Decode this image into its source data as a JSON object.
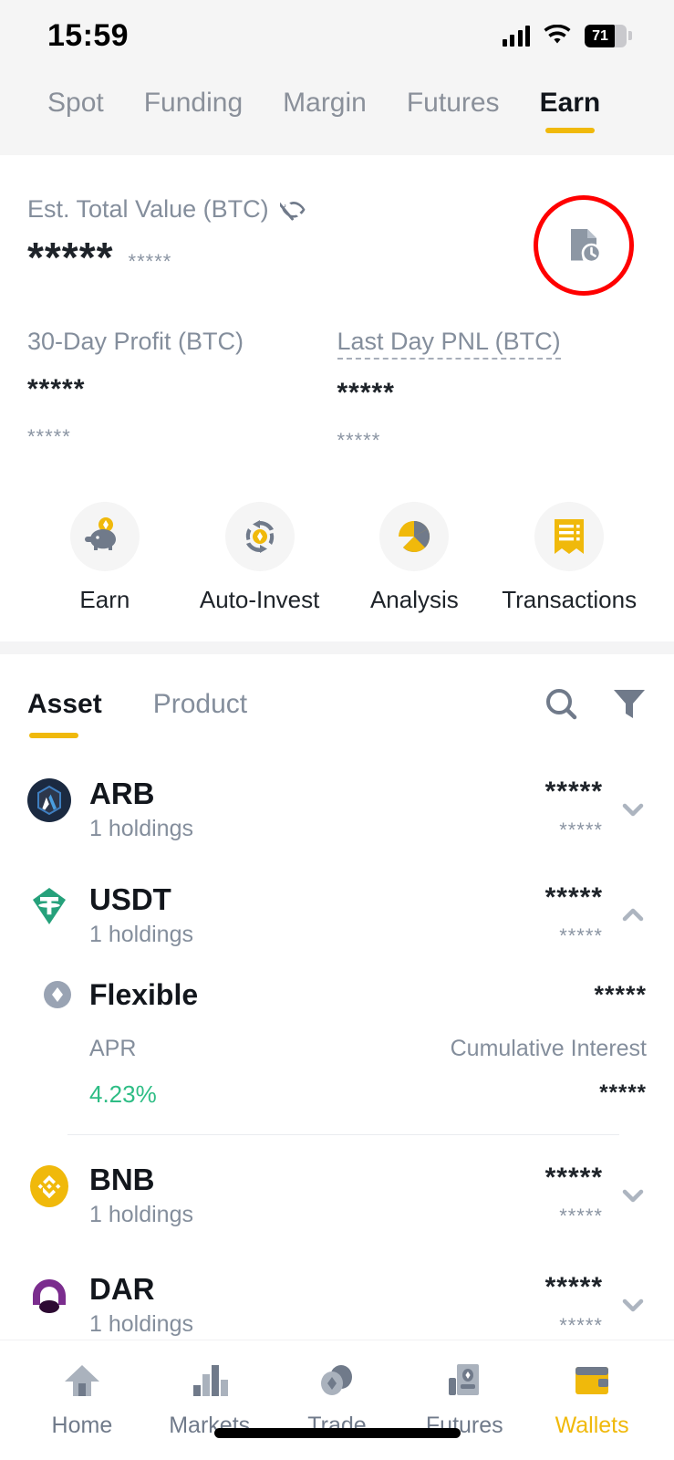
{
  "status_bar": {
    "time": "15:59",
    "battery_level": "71",
    "signal_icon": "signal-bars-icon",
    "wifi_icon": "wifi-icon",
    "battery_icon": "battery-icon"
  },
  "wallet_tabs": {
    "items": [
      {
        "label": "Spot",
        "active": false
      },
      {
        "label": "Funding",
        "active": false
      },
      {
        "label": "Margin",
        "active": false
      },
      {
        "label": "Futures",
        "active": false
      },
      {
        "label": "Earn",
        "active": true
      }
    ]
  },
  "balance": {
    "label": "Est. Total Value (BTC)",
    "hide_icon": "eye-off-icon",
    "value": "*****",
    "value_sub": "*****",
    "history_icon": "order-history-icon",
    "highlight_color": "#ff0000"
  },
  "pnl": [
    {
      "title": "30-Day Profit (BTC)",
      "value": "*****",
      "sub": "*****",
      "dashed": false
    },
    {
      "title": "Last Day PNL (BTC)",
      "value": "*****",
      "sub": "*****",
      "dashed": true
    }
  ],
  "quick_actions": [
    {
      "label": "Earn",
      "icon": "piggy-bank-icon"
    },
    {
      "label": "Auto-Invest",
      "icon": "auto-invest-refresh-icon"
    },
    {
      "label": "Analysis",
      "icon": "pie-chart-icon"
    },
    {
      "label": "Transactions",
      "icon": "receipt-icon"
    }
  ],
  "list_header": {
    "tabs": [
      {
        "label": "Asset",
        "active": true
      },
      {
        "label": "Product",
        "active": false
      }
    ],
    "search_icon": "search-icon",
    "filter_icon": "filter-icon"
  },
  "assets": [
    {
      "symbol": "ARB",
      "holdings": "1 holdings",
      "amount": "*****",
      "amount_sub": "*****",
      "icon": "arb-coin-icon",
      "expanded": false,
      "chevron": "chevron-down-icon"
    },
    {
      "symbol": "USDT",
      "holdings": "1 holdings",
      "amount": "*****",
      "amount_sub": "*****",
      "icon": "usdt-coin-icon",
      "expanded": true,
      "chevron": "chevron-up-icon"
    },
    {
      "symbol": "BNB",
      "holdings": "1 holdings",
      "amount": "*****",
      "amount_sub": "*****",
      "icon": "bnb-coin-icon",
      "expanded": false,
      "chevron": "chevron-down-icon"
    },
    {
      "symbol": "DAR",
      "holdings": "1 holdings",
      "amount": "*****",
      "amount_sub": "*****",
      "icon": "dar-coin-icon",
      "expanded": false,
      "chevron": "chevron-down-icon"
    }
  ],
  "product_detail": {
    "name": "Flexible",
    "badge_icon": "flexible-diamond-icon",
    "amount": "*****",
    "apr_label": "APR",
    "apr_value": "4.23%",
    "apr_color": "#2ebd85",
    "interest_label": "Cumulative Interest",
    "interest_value": "*****"
  },
  "bottom_nav": [
    {
      "label": "Home",
      "icon": "home-icon",
      "active": false
    },
    {
      "label": "Markets",
      "icon": "markets-bars-icon",
      "active": false
    },
    {
      "label": "Trade",
      "icon": "trade-circles-icon",
      "active": false
    },
    {
      "label": "Futures",
      "icon": "futures-icon",
      "active": false
    },
    {
      "label": "Wallets",
      "icon": "wallet-icon",
      "active": true
    }
  ],
  "accent_color": "#f0b90b"
}
